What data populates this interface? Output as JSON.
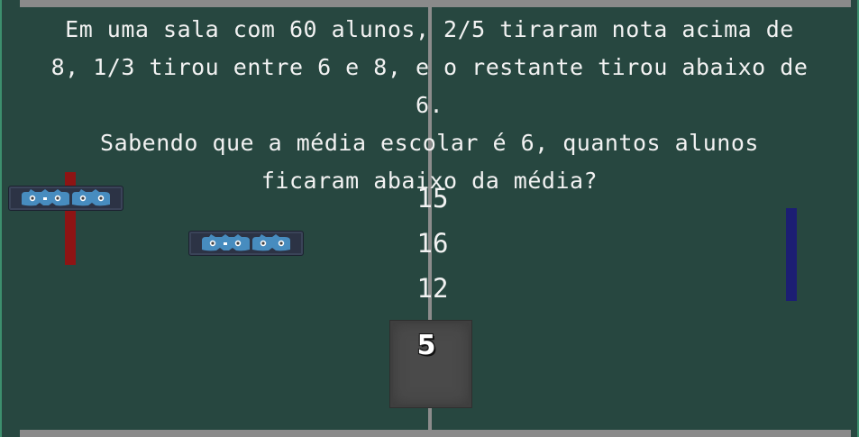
{
  "question": {
    "lines": [
      "Em uma sala com 60 alunos, 2/5 tiraram nota acima de",
      "8, 1/3 tirou entre 6 e 8, e o restante tirou abaixo de 6.",
      "Sabendo que a média escolar é 6, quantos alunos",
      "ficaram abaixo da média?"
    ]
  },
  "options": [
    "15",
    "16",
    "12"
  ],
  "answer_box": {
    "value": "5"
  },
  "colors": {
    "background": "#274740",
    "walls": "#8a8a8a",
    "left_paddle": "#8e1414",
    "right_paddle": "#1c1e73",
    "sprite_accent": "#478cbf"
  },
  "sprites": [
    {
      "icon": "godot-logo-icon"
    },
    {
      "icon": "godot-logo-icon"
    }
  ]
}
